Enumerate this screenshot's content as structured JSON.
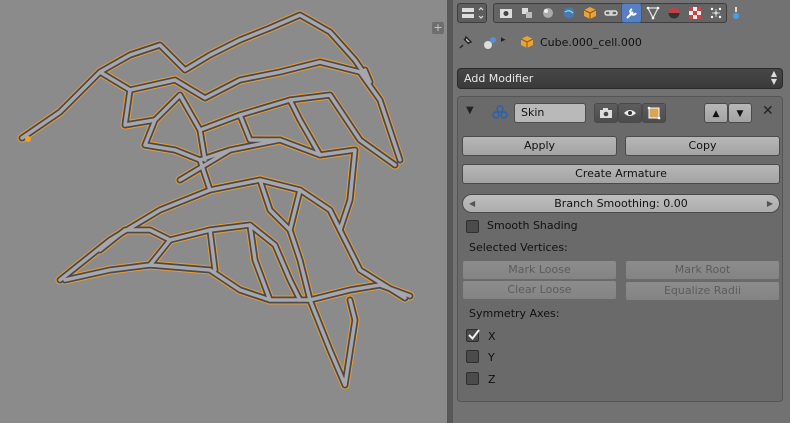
{
  "panel": {
    "breadcrumb": {
      "object_name": "Cube.000_cell.000"
    },
    "add_modifier_label": "Add Modifier",
    "modifier": {
      "name": "Skin",
      "apply_label": "Apply",
      "copy_label": "Copy",
      "create_armature_label": "Create Armature",
      "branch_smoothing_label": "Branch Smoothing: 0.00",
      "branch_smoothing_value": 0.0,
      "smooth_shading": {
        "label": "Smooth Shading",
        "checked": false
      },
      "selected_vertices_label": "Selected Vertices:",
      "mark_loose_label": "Mark Loose",
      "mark_root_label": "Mark Root",
      "clear_loose_label": "Clear Loose",
      "equalize_radii_label": "Equalize Radii",
      "symmetry_label": "Symmetry Axes:",
      "axes": [
        {
          "label": "X",
          "checked": true
        },
        {
          "label": "Y",
          "checked": false
        },
        {
          "label": "Z",
          "checked": false
        }
      ]
    }
  },
  "icons": {
    "context_tabs": [
      "render-icon",
      "render-layers-icon",
      "scene-icon",
      "world-icon",
      "object-icon",
      "constraints-icon",
      "modifiers-icon",
      "data-icon",
      "material-icon",
      "texture-icon",
      "particles-icon",
      "physics-icon"
    ],
    "active_tab": "modifiers-icon"
  },
  "colors": {
    "active_tab": "#5680c2",
    "selection_outline": "#f0a030",
    "mesh": "#9a9a9e"
  }
}
